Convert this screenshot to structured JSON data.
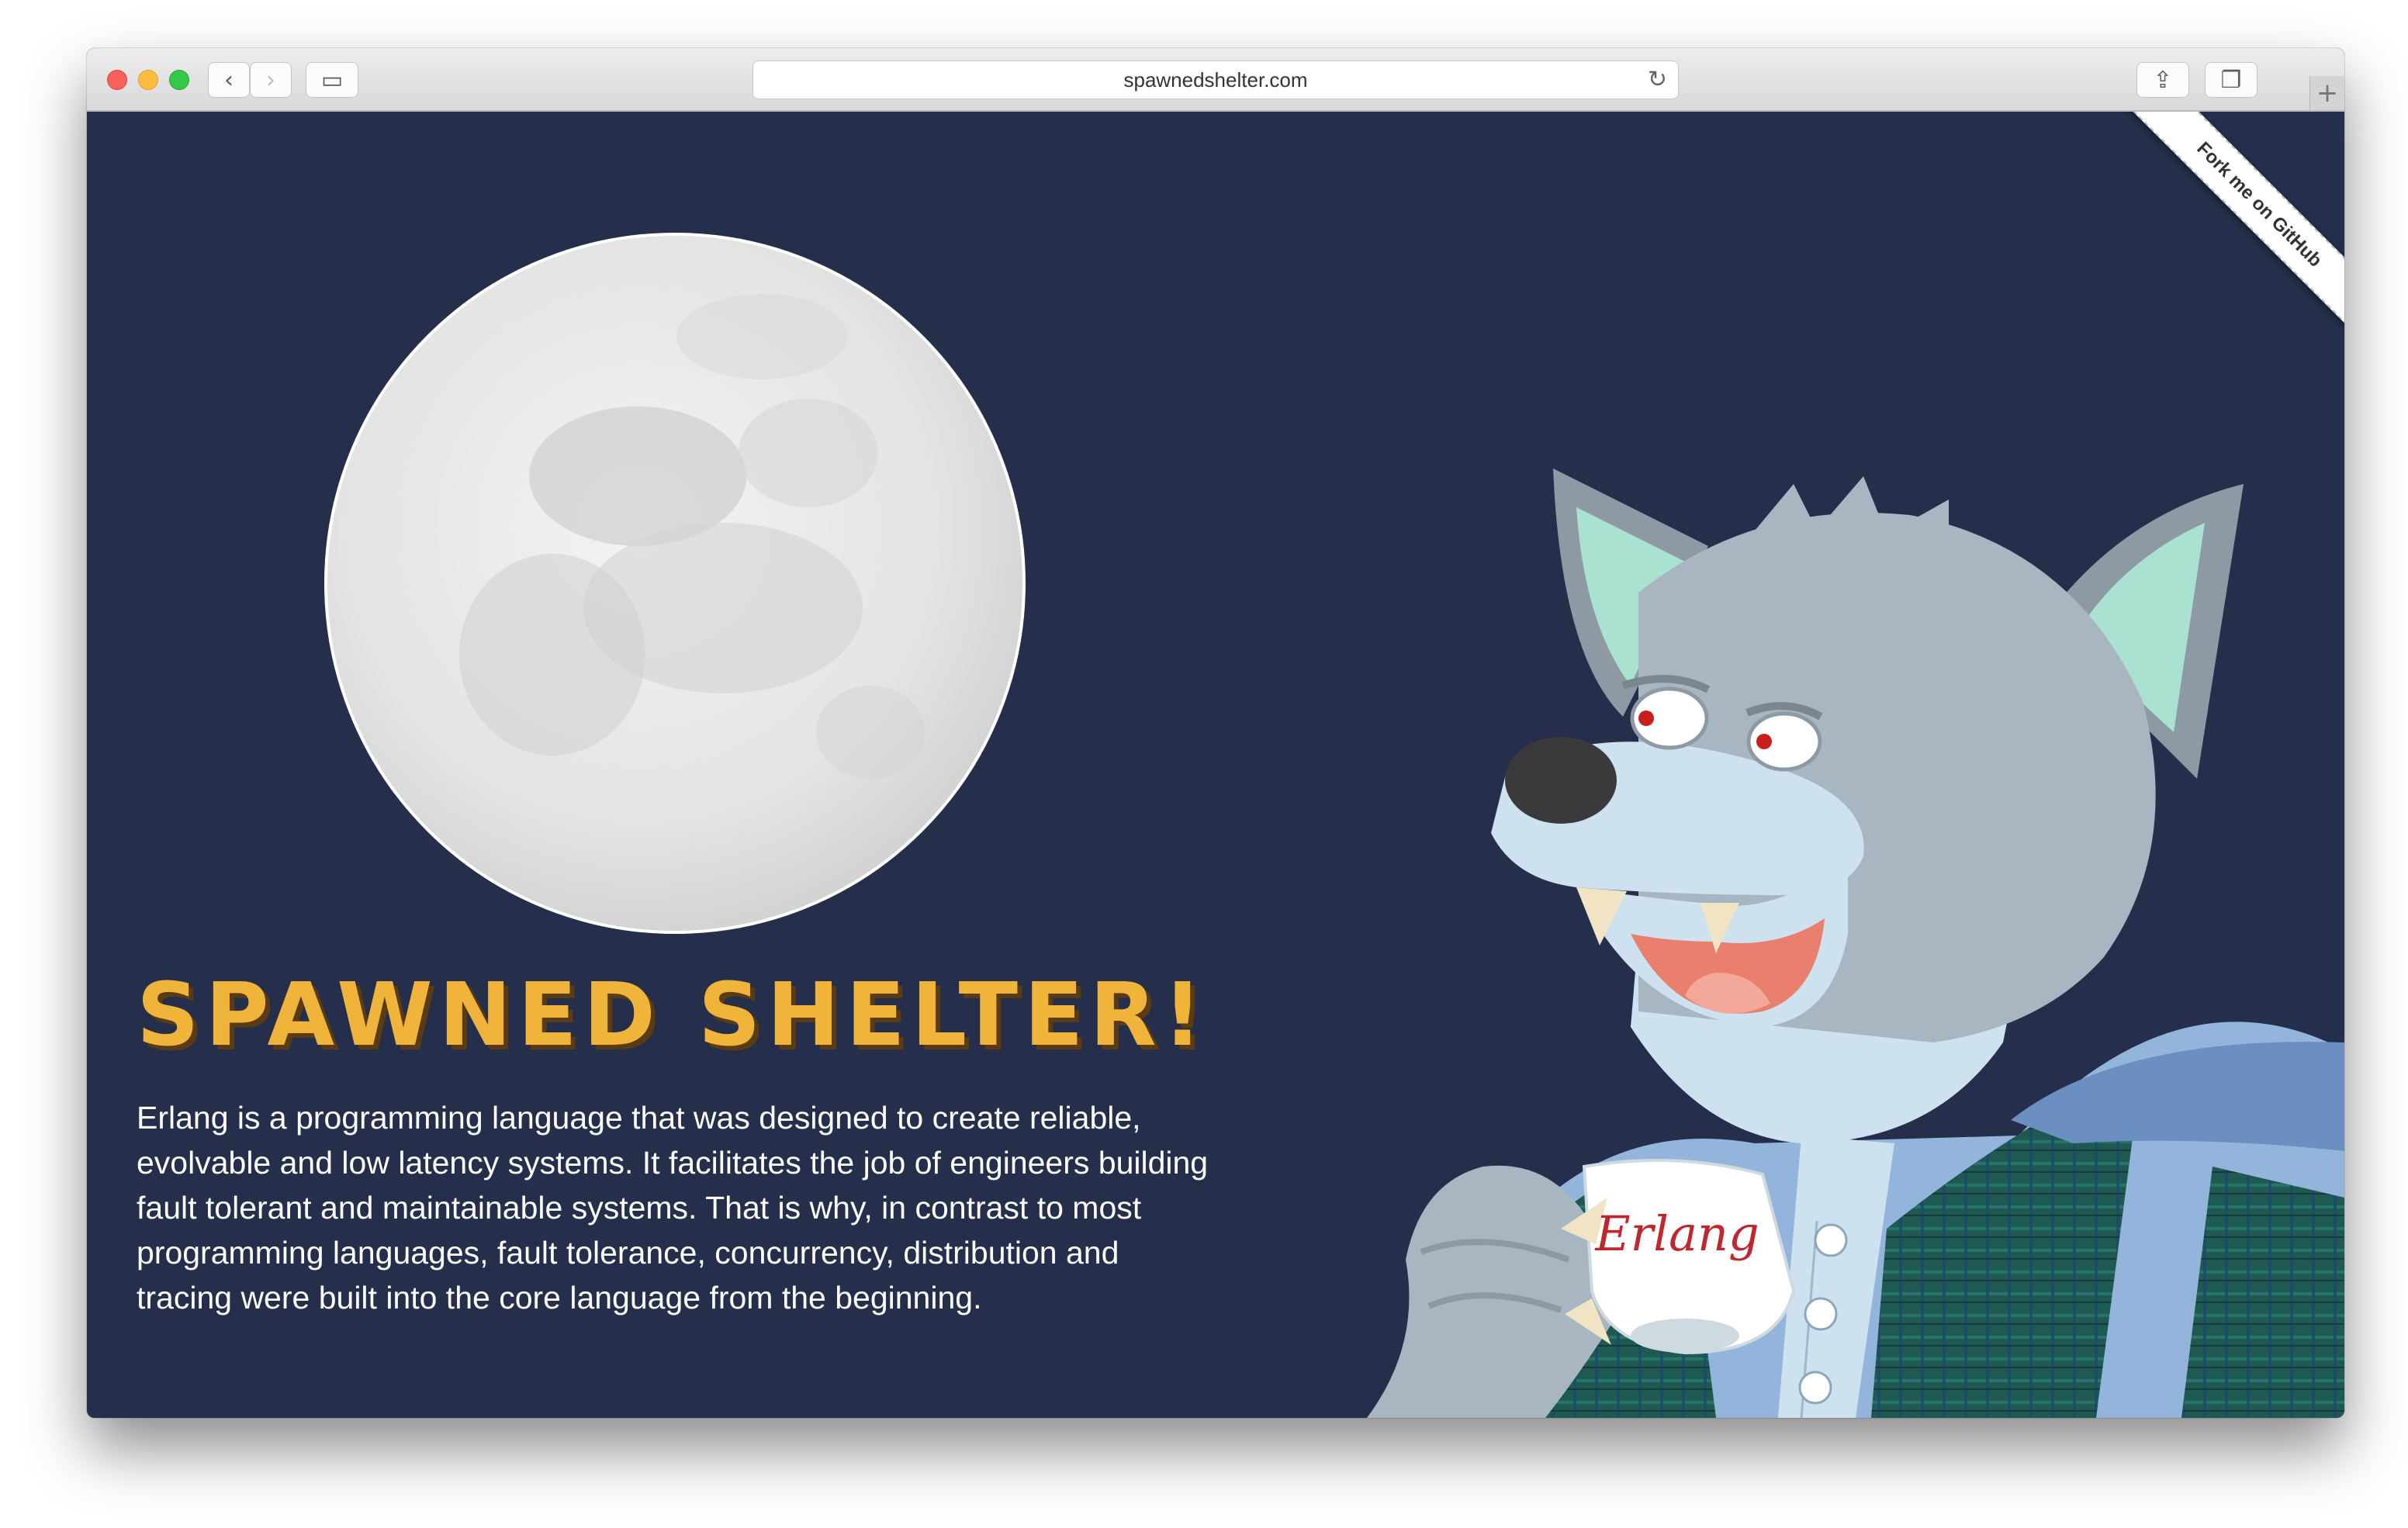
{
  "browser": {
    "url": "spawnedshelter.com",
    "back_icon": "‹",
    "forward_icon": "›",
    "sidebar_icon": "▭",
    "reload_icon": "↻",
    "share_icon": "⇪",
    "tabs_icon": "❐",
    "newtab_icon": "+"
  },
  "page": {
    "ribbon": "Fork me on GitHub",
    "title": "SPAWNED SHELTER!",
    "description": "Erlang is a programming language that was designed to create reliable, evolvable and low latency systems. It facilitates the job of engineers building fault tolerant and maintainable systems. That is why, in contrast to most programming languages, fault tolerance, concurrency, distribution and tracing were built into the core language from the beginning.",
    "cup_label": "Erlang"
  },
  "colors": {
    "background": "#252e4a",
    "title": "#f0b43a",
    "text": "#ffffff"
  }
}
